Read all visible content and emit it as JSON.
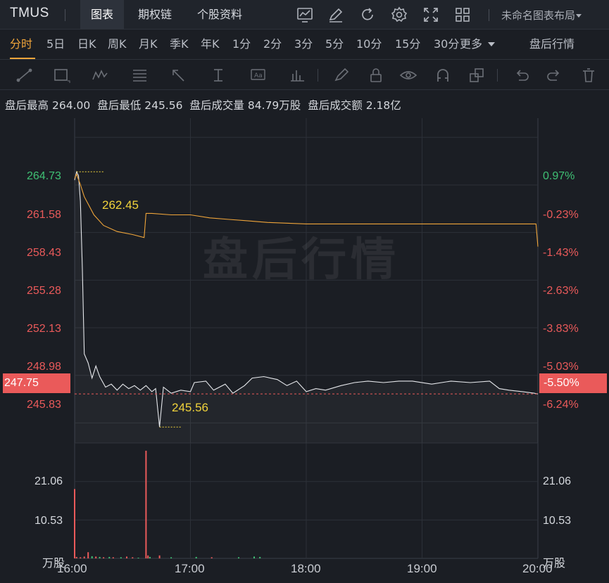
{
  "header": {
    "ticker": "TMUS",
    "tabs": [
      {
        "label": "图表",
        "active": true
      },
      {
        "label": "期权链",
        "active": false
      },
      {
        "label": "个股资料",
        "active": false
      }
    ],
    "tool_icons": [
      "indicator-icon",
      "draw-pen-icon",
      "refresh-icon",
      "settings-gear-icon",
      "fullscreen-icon",
      "layout-grid-icon"
    ],
    "layout_name": "未命名图表布局"
  },
  "periods": {
    "items": [
      "分时",
      "5日",
      "日K",
      "周K",
      "月K",
      "季K",
      "年K",
      "1分",
      "2分",
      "3分",
      "5分",
      "10分",
      "15分",
      "30分"
    ],
    "active": "分时",
    "more_label": "更多",
    "session_label": "盘后行情"
  },
  "drawing_tools": [
    "line-tool-icon",
    "rectangle-tool-icon",
    "pattern-tool-icon",
    "fibonacci-tool-icon",
    "arrow-tool-icon",
    "measure-tool-icon",
    "text-tool-icon",
    "volume-profile-icon",
    "brush-icon",
    "lock-icon",
    "eye-icon",
    "magnet-icon",
    "layers-icon",
    "undo-icon",
    "redo-icon",
    "trash-icon"
  ],
  "info": {
    "high_label": "盘后最高",
    "high_value": "264.00",
    "low_label": "盘后最低",
    "low_value": "245.56",
    "volume_label": "盘后成交量",
    "volume_value": "84.79万股",
    "amount_label": "盘后成交额",
    "amount_value": "2.18亿"
  },
  "watermark": "盘后行情",
  "current": {
    "price": "247.75",
    "change_pct": "-5.50%"
  },
  "annotations": {
    "high": "262.45",
    "low": "245.56"
  },
  "colors": {
    "up": "#3fc074",
    "down": "#ea5a5a",
    "accent": "#f0a53a",
    "price_line": "#e6e8ec",
    "avg_line": "#f0a53a",
    "annotation": "#f1d33b"
  },
  "chart_data": {
    "type": "line",
    "x_ticks": [
      "16:00",
      "17:00",
      "18:00",
      "19:00",
      "20:00"
    ],
    "price_axis": {
      "left_ticks": [
        "264.73",
        "261.58",
        "258.43",
        "255.28",
        "252.13",
        "248.98",
        "245.83"
      ],
      "right_ticks": [
        "0.97%",
        "-0.23%",
        "-1.43%",
        "-2.63%",
        "-3.83%",
        "-5.03%",
        "-6.24%"
      ],
      "ylim": [
        244.5,
        266.0
      ]
    },
    "volume_axis": {
      "ticks": [
        "21.06",
        "10.53"
      ],
      "unit": "万股",
      "ylim": [
        0,
        31.6
      ]
    },
    "series": [
      {
        "name": "price",
        "points": [
          [
            "16:00",
            261.9
          ],
          [
            "16:01",
            262.45
          ],
          [
            "16:02",
            262.2
          ],
          [
            "16:03",
            260.5
          ],
          [
            "16:04",
            256.0
          ],
          [
            "16:05",
            250.4
          ],
          [
            "16:07",
            249.8
          ],
          [
            "16:09",
            248.8
          ],
          [
            "16:11",
            249.6
          ],
          [
            "16:13",
            248.9
          ],
          [
            "16:16",
            248.2
          ],
          [
            "16:19",
            248.4
          ],
          [
            "16:22",
            248.0
          ],
          [
            "16:25",
            248.4
          ],
          [
            "16:28",
            248.1
          ],
          [
            "16:31",
            248.3
          ],
          [
            "16:34",
            248.0
          ],
          [
            "16:37",
            248.3
          ],
          [
            "16:40",
            247.9
          ],
          [
            "16:42",
            248.1
          ],
          [
            "16:43",
            246.8
          ],
          [
            "16:44",
            245.56
          ],
          [
            "16:45",
            246.9
          ],
          [
            "16:46",
            248.2
          ],
          [
            "16:50",
            247.8
          ],
          [
            "16:55",
            248.0
          ],
          [
            "17:00",
            247.9
          ],
          [
            "17:02",
            248.5
          ],
          [
            "17:08",
            248.6
          ],
          [
            "17:12",
            248.0
          ],
          [
            "17:18",
            248.4
          ],
          [
            "17:22",
            247.8
          ],
          [
            "17:28",
            248.3
          ],
          [
            "17:32",
            248.8
          ],
          [
            "17:38",
            248.9
          ],
          [
            "17:45",
            248.7
          ],
          [
            "17:50",
            248.3
          ],
          [
            "17:55",
            248.6
          ],
          [
            "18:00",
            247.9
          ],
          [
            "18:05",
            248.1
          ],
          [
            "18:10",
            248.0
          ],
          [
            "18:18",
            248.3
          ],
          [
            "18:25",
            248.5
          ],
          [
            "18:32",
            248.6
          ],
          [
            "18:40",
            248.5
          ],
          [
            "18:48",
            248.6
          ],
          [
            "18:55",
            248.6
          ],
          [
            "19:05",
            248.4
          ],
          [
            "19:15",
            248.6
          ],
          [
            "19:25",
            248.5
          ],
          [
            "19:35",
            248.6
          ],
          [
            "19:40",
            248.1
          ],
          [
            "19:45",
            248.0
          ],
          [
            "19:52",
            247.9
          ],
          [
            "19:58",
            247.8
          ],
          [
            "20:00",
            247.75
          ]
        ]
      },
      {
        "name": "average",
        "points": [
          [
            "16:00",
            262.0
          ],
          [
            "16:01",
            262.3
          ],
          [
            "16:03",
            261.6
          ],
          [
            "16:05",
            260.8
          ],
          [
            "16:10",
            259.6
          ],
          [
            "16:15",
            258.9
          ],
          [
            "16:22",
            258.5
          ],
          [
            "16:30",
            258.3
          ],
          [
            "16:36",
            258.1
          ],
          [
            "16:37",
            259.7
          ],
          [
            "16:40",
            259.7
          ],
          [
            "16:50",
            259.6
          ],
          [
            "17:00",
            259.6
          ],
          [
            "17:10",
            259.4
          ],
          [
            "17:20",
            259.3
          ],
          [
            "17:30",
            259.2
          ],
          [
            "17:40",
            259.1
          ],
          [
            "18:00",
            259.0
          ],
          [
            "18:30",
            259.0
          ],
          [
            "19:00",
            259.0
          ],
          [
            "19:30",
            259.0
          ],
          [
            "19:59",
            259.0
          ],
          [
            "20:00",
            257.5
          ]
        ]
      }
    ],
    "volume": [
      {
        "time": "16:00",
        "value": 19.0,
        "dir": "down"
      },
      {
        "time": "16:01",
        "value": 0.4,
        "dir": "down"
      },
      {
        "time": "16:03",
        "value": 0.3,
        "dir": "down"
      },
      {
        "time": "16:05",
        "value": 0.5,
        "dir": "down"
      },
      {
        "time": "16:07",
        "value": 1.7,
        "dir": "down"
      },
      {
        "time": "16:09",
        "value": 0.6,
        "dir": "up"
      },
      {
        "time": "16:11",
        "value": 0.5,
        "dir": "down"
      },
      {
        "time": "16:13",
        "value": 0.4,
        "dir": "up"
      },
      {
        "time": "16:15",
        "value": 0.3,
        "dir": "down"
      },
      {
        "time": "16:18",
        "value": 0.4,
        "dir": "up"
      },
      {
        "time": "16:20",
        "value": 0.3,
        "dir": "down"
      },
      {
        "time": "16:24",
        "value": 0.3,
        "dir": "up"
      },
      {
        "time": "16:27",
        "value": 0.5,
        "dir": "down"
      },
      {
        "time": "16:30",
        "value": 0.3,
        "dir": "down"
      },
      {
        "time": "16:33",
        "value": 0.2,
        "dir": "up"
      },
      {
        "time": "16:37",
        "value": 29.5,
        "dir": "down"
      },
      {
        "time": "16:38",
        "value": 0.8,
        "dir": "down"
      },
      {
        "time": "16:39",
        "value": 0.4,
        "dir": "up"
      },
      {
        "time": "16:44",
        "value": 0.8,
        "dir": "down"
      },
      {
        "time": "16:50",
        "value": 0.3,
        "dir": "up"
      },
      {
        "time": "17:03",
        "value": 0.4,
        "dir": "up"
      },
      {
        "time": "17:11",
        "value": 0.3,
        "dir": "down"
      },
      {
        "time": "17:25",
        "value": 0.3,
        "dir": "up"
      },
      {
        "time": "17:33",
        "value": 0.5,
        "dir": "up"
      },
      {
        "time": "17:36",
        "value": 0.4,
        "dir": "up"
      }
    ]
  }
}
